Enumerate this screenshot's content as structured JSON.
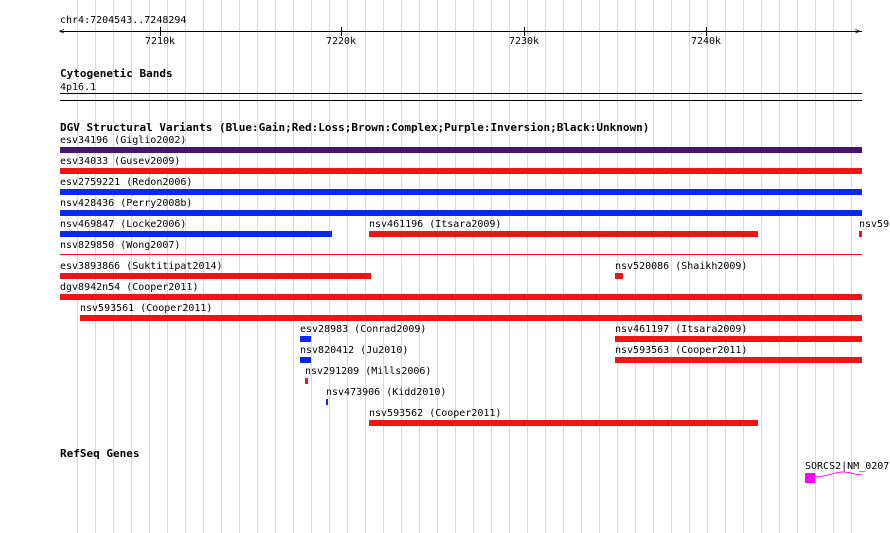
{
  "ruler": {
    "locus": "chr4:7204543..7248294",
    "ticks": [
      "7210k",
      "7220k",
      "7230k",
      "7240k"
    ]
  },
  "tracks": {
    "cytoband": {
      "title": "Cytogenetic Bands",
      "band": "4p16.1"
    },
    "dgv": {
      "title": "DGV Structural Variants (Blue:Gain;Red:Loss;Brown:Complex;Purple:Inversion;Black:Unknown)",
      "features": [
        {
          "label": "esv34196 (Giglio2002)",
          "type": "inversion"
        },
        {
          "label": "esv34033 (Gusev2009)",
          "type": "loss"
        },
        {
          "label": "esv2759221 (Redon2006)",
          "type": "gain"
        },
        {
          "label": "nsv428436 (Perry2008b)",
          "type": "gain"
        },
        {
          "label": "nsv469847 (Locke2006)",
          "type": "gain"
        },
        {
          "label": "nsv461196 (Itsara2009)",
          "type": "loss"
        },
        {
          "label": "nsv59",
          "type": "loss"
        },
        {
          "label": "nsv829850 (Wong2007)",
          "type": "loss"
        },
        {
          "label": "esv3893866 (Suktitipat2014)",
          "type": "loss"
        },
        {
          "label": "nsv520086 (Shaikh2009)",
          "type": "loss"
        },
        {
          "label": "dgv8942n54 (Cooper2011)",
          "type": "loss"
        },
        {
          "label": "nsv593561 (Cooper2011)",
          "type": "loss"
        },
        {
          "label": "esv28983 (Conrad2009)",
          "type": "gain"
        },
        {
          "label": "nsv461197 (Itsara2009)",
          "type": "loss"
        },
        {
          "label": "nsv820412 (Ju2010)",
          "type": "gain"
        },
        {
          "label": "nsv593563 (Cooper2011)",
          "type": "loss"
        },
        {
          "label": "nsv291209 (Mills2006)",
          "type": "loss"
        },
        {
          "label": "nsv473906 (Kidd2010)",
          "type": "gain"
        },
        {
          "label": "nsv593562 (Cooper2011)",
          "type": "loss"
        }
      ]
    },
    "refseq": {
      "title": "RefSeq Genes",
      "gene_label": "SORCS2|NM_0207"
    }
  },
  "colors": {
    "gain": "#0a28f0",
    "loss": "#f01414",
    "inversion": "#46166e",
    "gene": "#ff00ff",
    "grid": "#c8dcff"
  }
}
